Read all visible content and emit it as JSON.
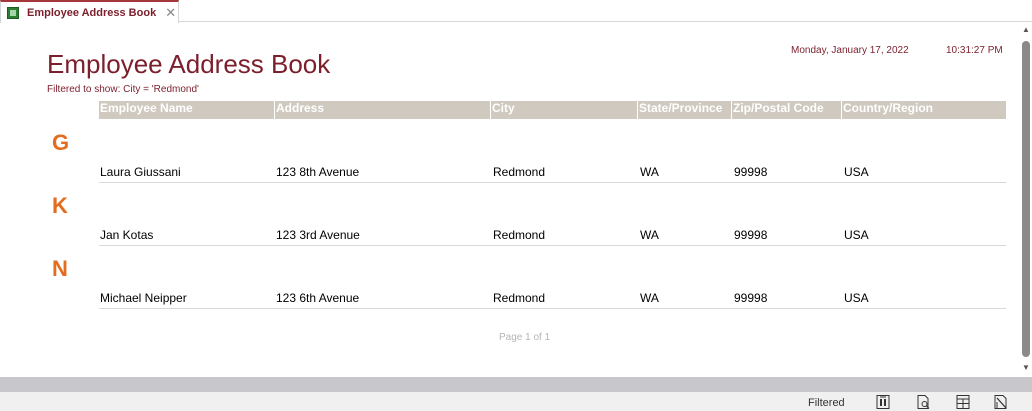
{
  "tab": {
    "title": "Employee Address Book",
    "close": "✕"
  },
  "report": {
    "title": "Employee Address Book",
    "filter": "Filtered to show: City = 'Redmond'",
    "date": "Monday, January 17, 2022",
    "time": "10:31:27 PM",
    "columns": [
      "Employee Name",
      "Address",
      "City",
      "State/Province",
      "Zip/Postal Code",
      "Country/Region"
    ],
    "groups": [
      {
        "letter": "G",
        "row": [
          "Laura Giussani",
          "123 8th Avenue",
          "Redmond",
          "WA",
          "99998",
          "USA"
        ]
      },
      {
        "letter": "K",
        "row": [
          "Jan Kotas",
          "123 3rd Avenue",
          "Redmond",
          "WA",
          "99998",
          "USA"
        ]
      },
      {
        "letter": "N",
        "row": [
          "Michael Neipper",
          "123 6th Avenue",
          "Redmond",
          "WA",
          "99998",
          "USA"
        ]
      }
    ],
    "page_footer": "Page 1 of 1"
  },
  "statusbar": {
    "filter_status": "Filtered",
    "views": [
      "report-view-icon",
      "print-preview-icon",
      "layout-view-icon",
      "design-view-icon"
    ]
  },
  "colors": {
    "accent": "#7b1f2c",
    "group_letter": "#e36c1f",
    "header_bar": "#cfc9bf"
  }
}
